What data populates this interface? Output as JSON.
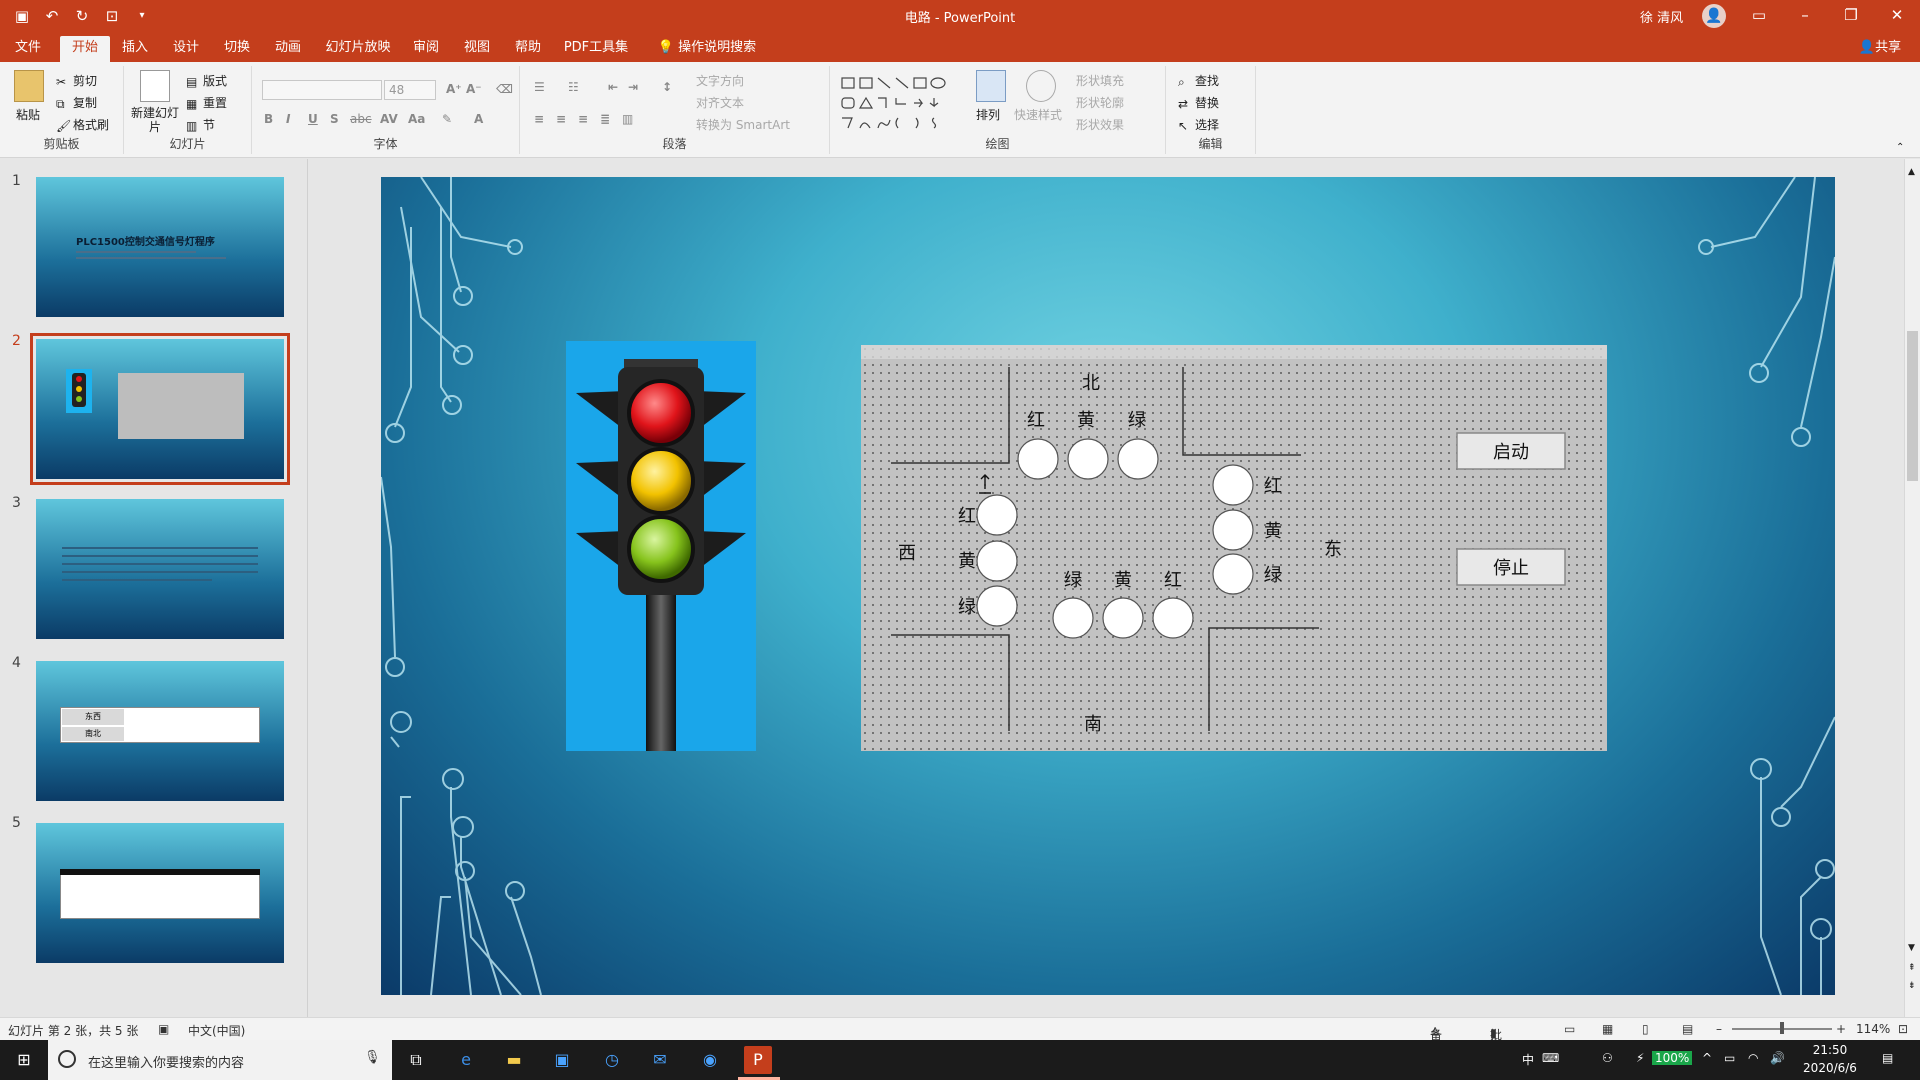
{
  "window": {
    "title": "电路  -  PowerPoint",
    "user": "徐 清风",
    "share": "共享"
  },
  "tabs": [
    "文件",
    "开始",
    "插入",
    "设计",
    "切换",
    "动画",
    "幻灯片放映",
    "审阅",
    "视图",
    "帮助",
    "PDF工具集"
  ],
  "tell_me": "操作说明搜索",
  "ribbon": {
    "clipboard": {
      "label": "剪贴板",
      "paste": "粘贴",
      "cut": "剪切",
      "copy": "复制",
      "painter": "格式刷"
    },
    "slides": {
      "label": "幻灯片",
      "new_slide": "新建幻灯片",
      "layout": "版式",
      "reset": "重置",
      "section": "节"
    },
    "font": {
      "label": "字体",
      "size": "48",
      "buttons": [
        "B",
        "I",
        "U",
        "S",
        "abc",
        "AV",
        "Aa",
        "A"
      ]
    },
    "paragraph": {
      "label": "段落",
      "text_direction": "文字方向",
      "align_text": "对齐文本",
      "smartart": "转换为 SmartArt"
    },
    "drawing": {
      "label": "绘图",
      "arrange": "排列",
      "quick_styles": "快速样式",
      "shape_fill": "形状填充",
      "shape_outline": "形状轮廓",
      "shape_effects": "形状效果"
    },
    "editing": {
      "label": "编辑",
      "find": "查找",
      "replace": "替换",
      "select": "选择"
    }
  },
  "thumbnails": [
    {
      "num": "1",
      "title": "PLC1500控制交通信号灯程序"
    },
    {
      "num": "2",
      "title": ""
    },
    {
      "num": "3",
      "title": ""
    },
    {
      "num": "4",
      "title": ""
    },
    {
      "num": "5",
      "title": ""
    }
  ],
  "slide": {
    "directions": {
      "north": "北",
      "south": "南",
      "east": "东",
      "west": "西"
    },
    "colors": {
      "red": "红",
      "yellow": "黄",
      "green": "绿"
    },
    "buttons": {
      "start": "启动",
      "stop": "停止"
    },
    "thumb4": {
      "row1": "东西",
      "row2": "南北"
    },
    "lamp_colors": {
      "red": "#e0141a",
      "yellow": "#f2c200",
      "green": "#86c31c"
    }
  },
  "status": {
    "slide_info": "幻灯片 第 2 张，共 5 张",
    "language": "中文(中国)",
    "notes": "备注",
    "comments": "批注",
    "zoom": "114%"
  },
  "taskbar": {
    "search_placeholder": "在这里输入你要搜索的内容",
    "time": "21:50",
    "date": "2020/6/6",
    "battery": "100%",
    "ime": "中"
  }
}
